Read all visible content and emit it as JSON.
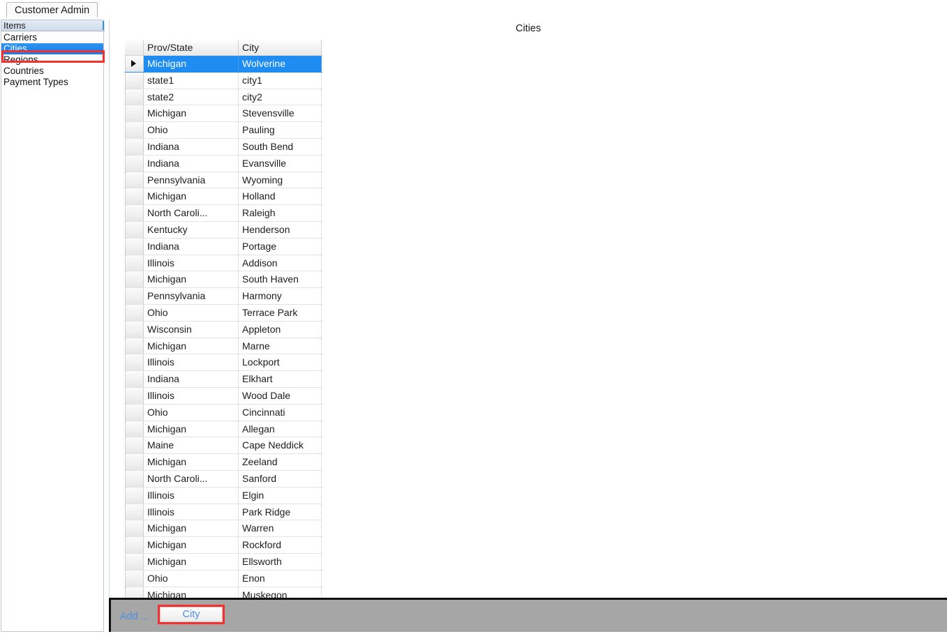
{
  "window": {
    "tab_label": "Customer Admin"
  },
  "sidebar": {
    "header": "Items",
    "items": [
      {
        "label": "Carriers",
        "selected": false
      },
      {
        "label": "Cities",
        "selected": true
      },
      {
        "label": "Regions",
        "selected": false
      },
      {
        "label": "Countries",
        "selected": false
      },
      {
        "label": "Payment Types",
        "selected": false
      }
    ]
  },
  "main": {
    "title": "Cities",
    "grid": {
      "columns": [
        "",
        "Prov/State",
        "City"
      ],
      "rows": [
        {
          "state": "Michigan",
          "city": "Wolverine",
          "selected": true
        },
        {
          "state": "state1",
          "city": "city1",
          "selected": false
        },
        {
          "state": "state2",
          "city": "city2",
          "selected": false
        },
        {
          "state": "Michigan",
          "city": "Stevensville",
          "selected": false
        },
        {
          "state": "Ohio",
          "city": "Pauling",
          "selected": false
        },
        {
          "state": "Indiana",
          "city": "South Bend",
          "selected": false
        },
        {
          "state": "Indiana",
          "city": "Evansville",
          "selected": false
        },
        {
          "state": "Pennsylvania",
          "city": "Wyoming",
          "selected": false
        },
        {
          "state": "Michigan",
          "city": "Holland",
          "selected": false
        },
        {
          "state": "North Caroli...",
          "city": "Raleigh",
          "selected": false
        },
        {
          "state": "Kentucky",
          "city": "Henderson",
          "selected": false
        },
        {
          "state": "Indiana",
          "city": "Portage",
          "selected": false
        },
        {
          "state": "Illinois",
          "city": "Addison",
          "selected": false
        },
        {
          "state": "Michigan",
          "city": "South Haven",
          "selected": false
        },
        {
          "state": "Pennsylvania",
          "city": "Harmony",
          "selected": false
        },
        {
          "state": "Ohio",
          "city": "Terrace Park",
          "selected": false
        },
        {
          "state": "Wisconsin",
          "city": "Appleton",
          "selected": false
        },
        {
          "state": "Michigan",
          "city": "Marne",
          "selected": false
        },
        {
          "state": "Illinois",
          "city": "Lockport",
          "selected": false
        },
        {
          "state": "Indiana",
          "city": "Elkhart",
          "selected": false
        },
        {
          "state": "Illinois",
          "city": "Wood Dale",
          "selected": false
        },
        {
          "state": "Ohio",
          "city": "Cincinnati",
          "selected": false
        },
        {
          "state": "Michigan",
          "city": "Allegan",
          "selected": false
        },
        {
          "state": "Maine",
          "city": "Cape Neddick",
          "selected": false
        },
        {
          "state": "Michigan",
          "city": "Zeeland",
          "selected": false
        },
        {
          "state": "North Caroli...",
          "city": "Sanford",
          "selected": false
        },
        {
          "state": "Illinois",
          "city": "Elgin",
          "selected": false
        },
        {
          "state": "Illinois",
          "city": "Park Ridge",
          "selected": false
        },
        {
          "state": "Michigan",
          "city": "Warren",
          "selected": false
        },
        {
          "state": "Michigan",
          "city": "Rockford",
          "selected": false
        },
        {
          "state": "Michigan",
          "city": "Ellsworth",
          "selected": false
        },
        {
          "state": "Ohio",
          "city": "Enon",
          "selected": false
        },
        {
          "state": "Michigan",
          "city": "Muskegon",
          "selected": false
        }
      ]
    }
  },
  "bottom_bar": {
    "add_label": "Add ...",
    "add_button_label": "City"
  },
  "colors": {
    "selection_blue": "#1e8cf0",
    "highlight_red": "#f4312f",
    "bottom_bar_gray": "#a6a6a6",
    "link_blue": "#4a90e2"
  }
}
